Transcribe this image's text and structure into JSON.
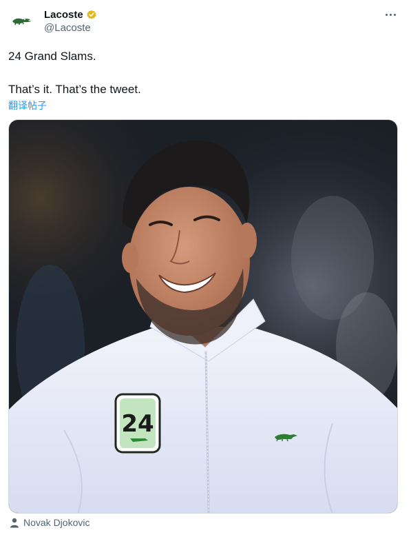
{
  "author": {
    "display_name": "Lacoste",
    "handle": "@Lacoste",
    "verified": true,
    "verified_color": "#e2b719"
  },
  "tweet": {
    "lines": [
      "24 Grand Slams.",
      "That’s it. That’s the tweet."
    ],
    "translate_label": "翻译帖子"
  },
  "media": {
    "jacket_badge_text": "24"
  },
  "tagged": {
    "person": "Novak Djokovic"
  },
  "icons": {
    "avatar": "lacoste-crocodile-icon",
    "verified": "verified-badge-icon",
    "more": "more-options-icon",
    "tag": "person-tag-icon"
  },
  "colors": {
    "link": "#1d9bf0",
    "secondary_text": "#536471",
    "jacket": "#e9ecf8",
    "badge_green": "#2e8a34"
  }
}
